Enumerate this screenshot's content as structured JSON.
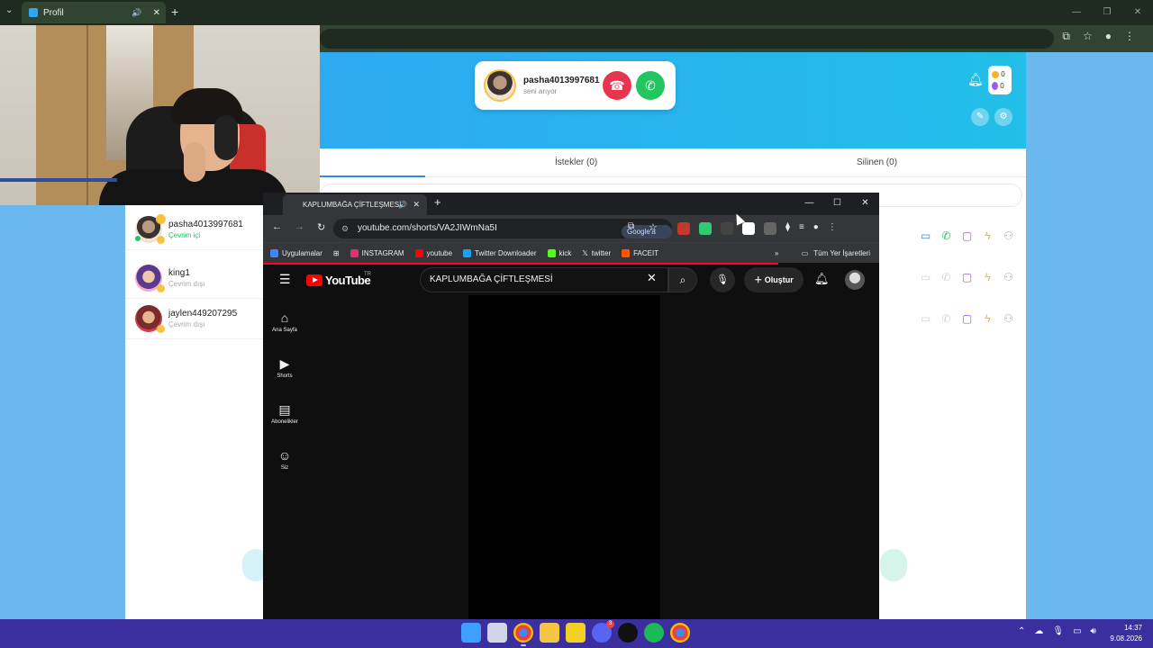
{
  "back_browser": {
    "tab_title": "Profil",
    "colors": {
      "tabbar": "#1f2b21",
      "toolbar": "#304431"
    }
  },
  "app": {
    "incoming_call": {
      "caller": "pasha4013997681",
      "subtitle": "seni arıyor"
    },
    "coins": {
      "gold": "0",
      "gem": "0"
    },
    "tabs": {
      "requests": "İstekler (0)",
      "deleted": "Silinen (0)"
    },
    "friends": [
      {
        "name": "pasha4013997681",
        "status": "Çevrim içi"
      },
      {
        "name": "king1",
        "status": "Çevrim dışı"
      },
      {
        "name": "jaylen449207295",
        "status": "Çevrim dışı"
      }
    ],
    "colors": {
      "header_start": "#31a4f6",
      "header_end": "#22bfe8",
      "decline": "#e8344e",
      "accept": "#22c55e",
      "online": "#22c55e"
    }
  },
  "front_browser": {
    "tab_title": "KAPLUMBAĞA ÇİFTLEŞMESİ",
    "url": "youtube.com/shorts/VA2JIWmNa5I",
    "google_sor": "Google'a Sor",
    "bookmarks": [
      "Uygulamalar",
      "INSTAGRAM",
      "youtube",
      "Twitter Downloader",
      "kick",
      "twitter",
      "FACEIT"
    ],
    "all_bookmarks": "Tüm Yer İşaretleri"
  },
  "youtube": {
    "logo": "YouTube",
    "region": "TR",
    "search_query": "KAPLUMBAĞA ÇİFTLEŞMESİ",
    "create_label": "Oluştur",
    "sidebar": [
      {
        "icon": "home-icon",
        "label": "Ana Sayfa"
      },
      {
        "icon": "shorts-icon",
        "label": "Shorts"
      },
      {
        "icon": "subscriptions-icon",
        "label": "Abonelikler"
      },
      {
        "icon": "you-icon",
        "label": "Siz"
      }
    ]
  },
  "taskbar": {
    "time": "14:37",
    "date": "9.08.2026",
    "discord_badge": "3"
  }
}
